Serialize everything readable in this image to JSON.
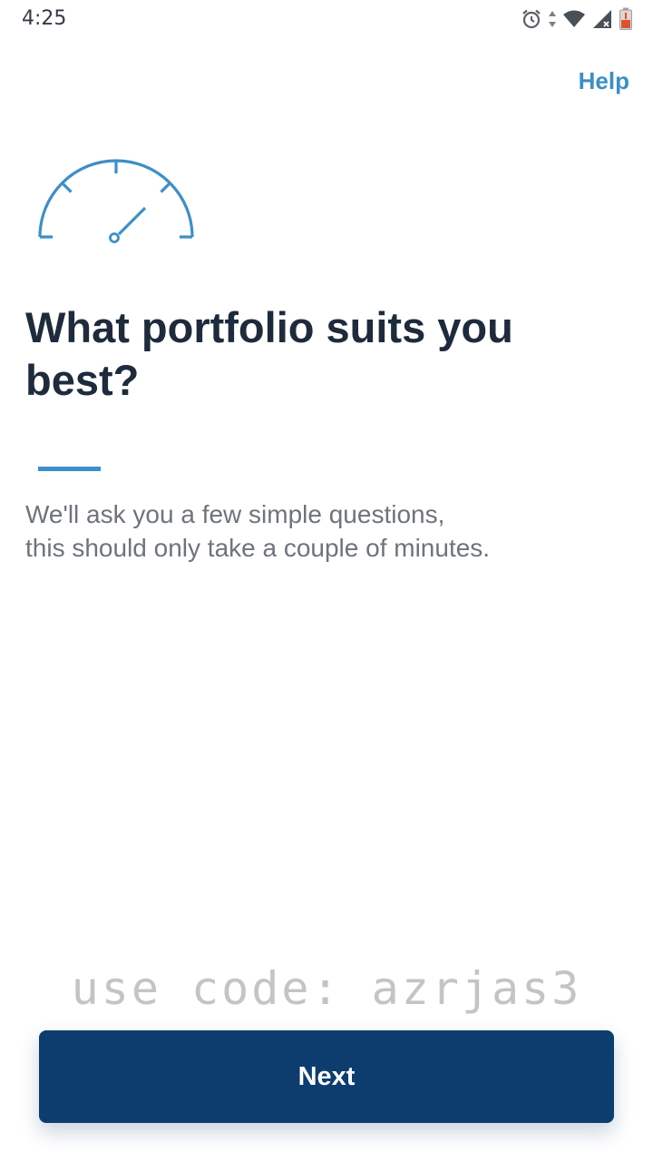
{
  "status_bar": {
    "time": "4:25",
    "icons": [
      "alarm-icon",
      "data-arrows-icon",
      "wifi-icon",
      "signal-icon",
      "battery-low-icon"
    ]
  },
  "header": {
    "help_label": "Help"
  },
  "illustration": {
    "icon": "gauge-icon",
    "color": "#3d8fc7"
  },
  "main": {
    "title": "What portfolio suits you best?",
    "description_lines": [
      "We'll ask you a few simple questions,",
      "this should only take a couple of minutes."
    ],
    "watermark": "use code: azrjas3"
  },
  "footer": {
    "next_label": "Next"
  },
  "colors": {
    "primary": "#0c3d6e",
    "accent": "#3a8fc6",
    "title": "#1e2b3c",
    "body_text": "#6e747c"
  }
}
